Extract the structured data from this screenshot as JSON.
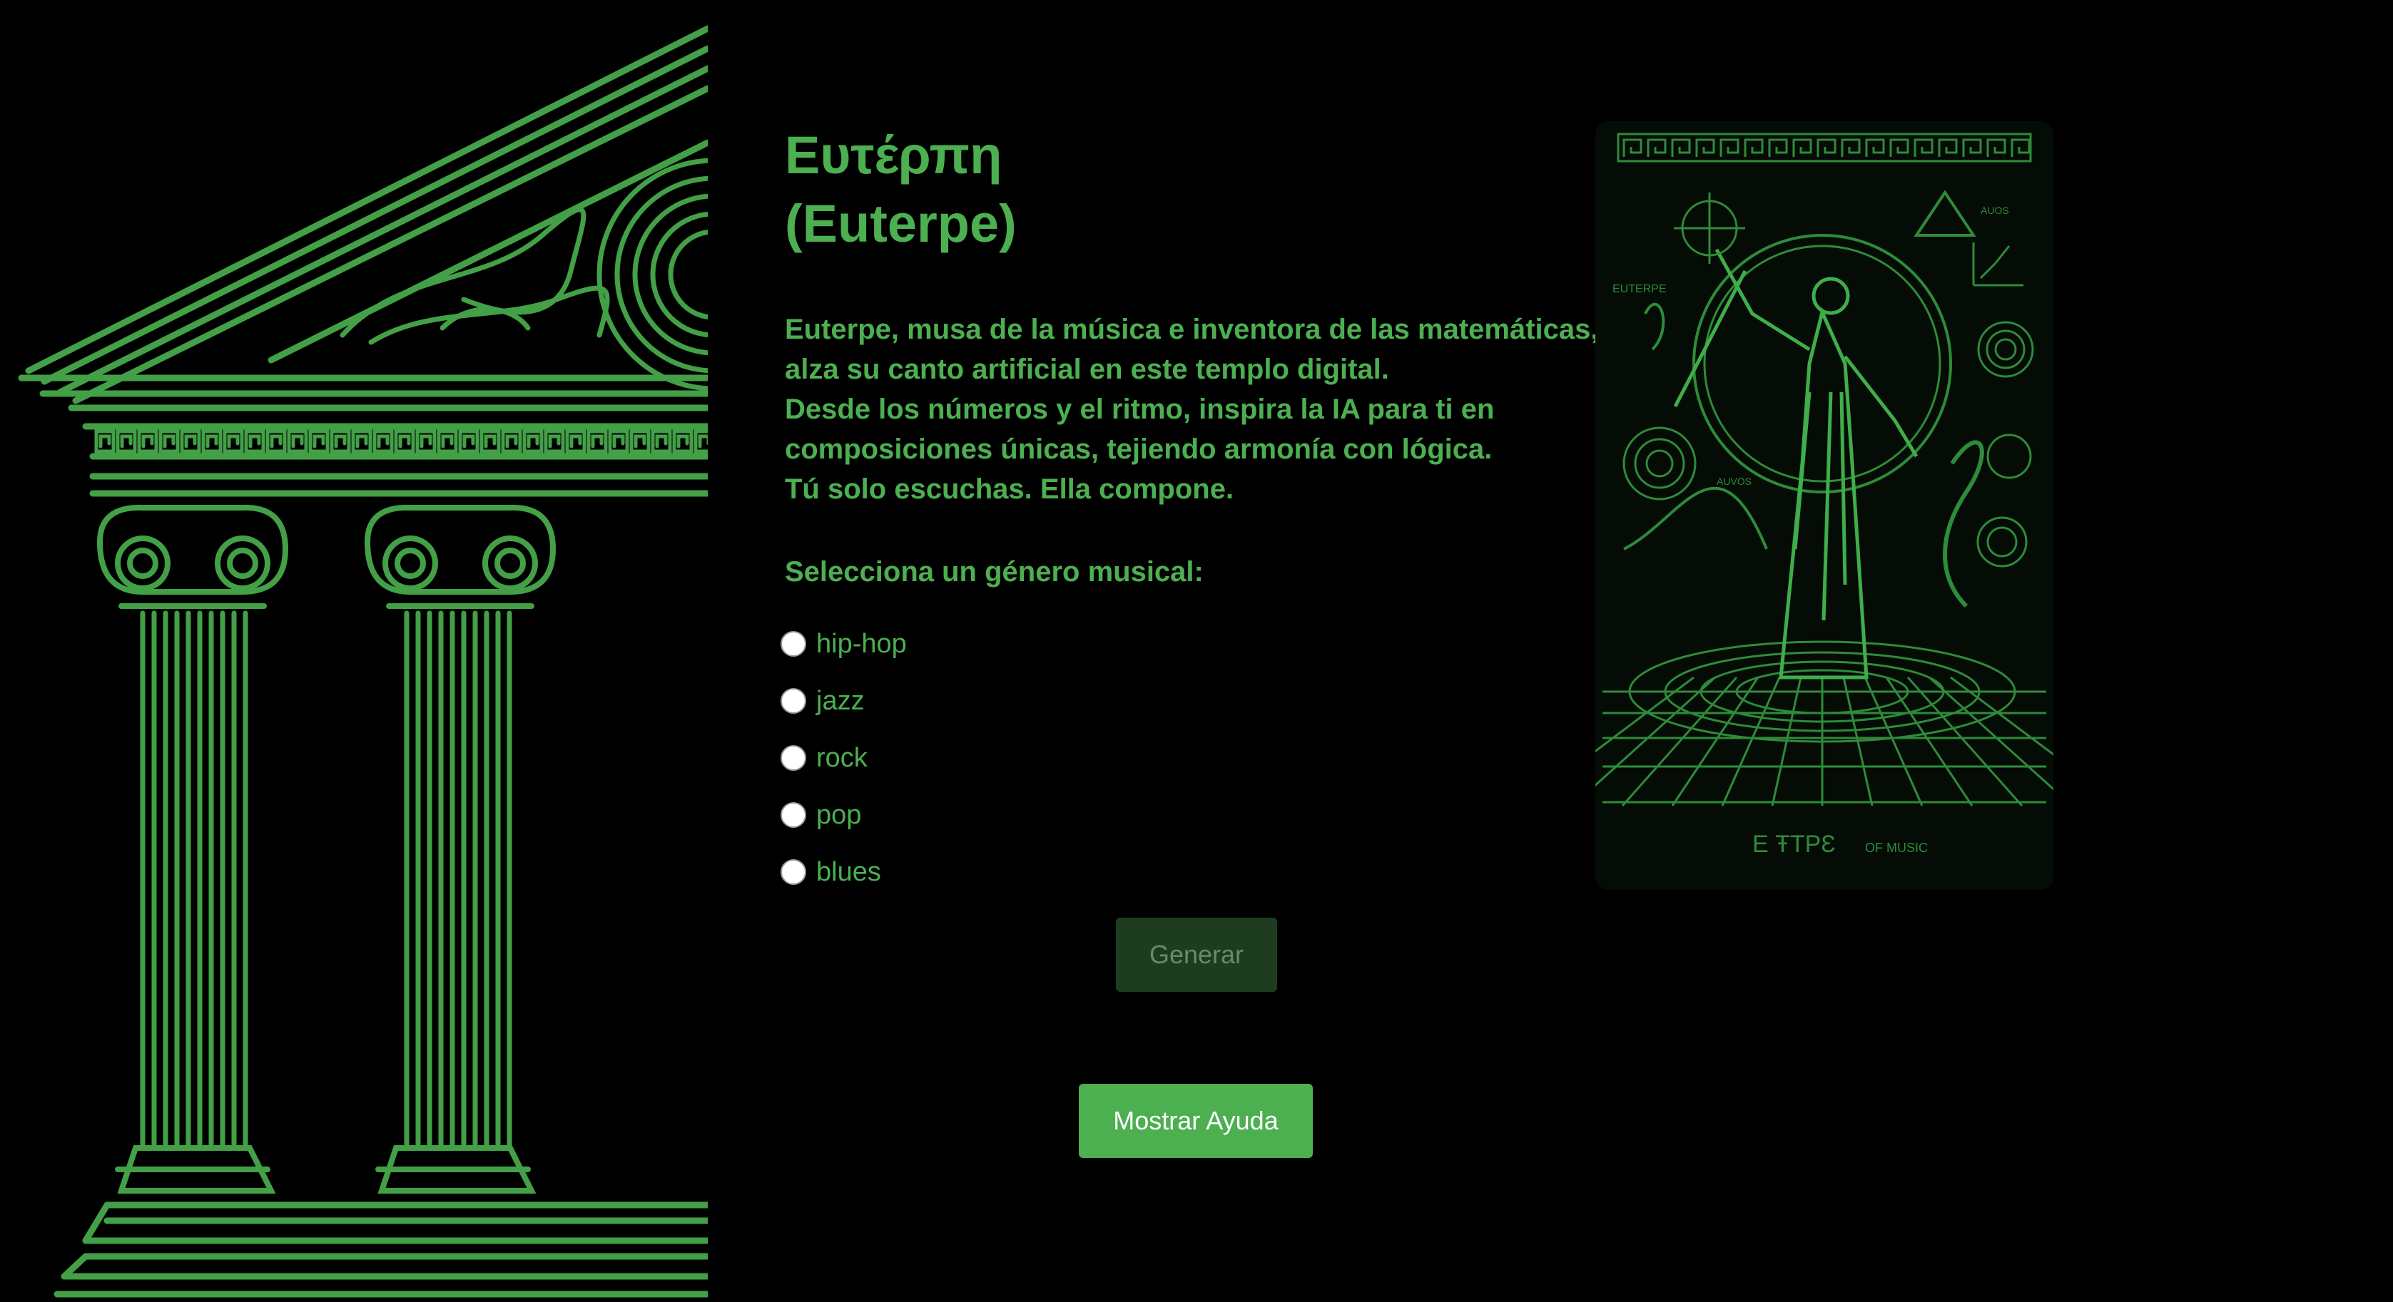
{
  "header": {
    "title_greek": "Ευτέρπη",
    "title_latin": "(Euterpe)"
  },
  "description": {
    "lines": [
      "Euterpe, musa de la música e inventora de las matemáticas,",
      "alza su canto artificial en este templo digital.",
      "Desde los números y el ritmo, inspira la IA para ti en",
      "composiciones únicas, tejiendo armonía con lógica.",
      "Tú solo escuchas. Ella compone."
    ]
  },
  "form": {
    "prompt": "Selecciona un género musical:",
    "genres": [
      "hip-hop",
      "jazz",
      "rock",
      "pop",
      "blues"
    ],
    "generate_label": "Generar",
    "help_label": "Mostrar Ayuda"
  },
  "illustration": {
    "label": "EUTERPE",
    "footer": "E ŦTPƐ",
    "footer_small": "OF MUSIC",
    "small_texts": [
      "AUOS",
      "AUVOS"
    ]
  },
  "colors": {
    "accent": "#4caf50",
    "background": "#000000",
    "disabled_button": "#1e3d20"
  }
}
